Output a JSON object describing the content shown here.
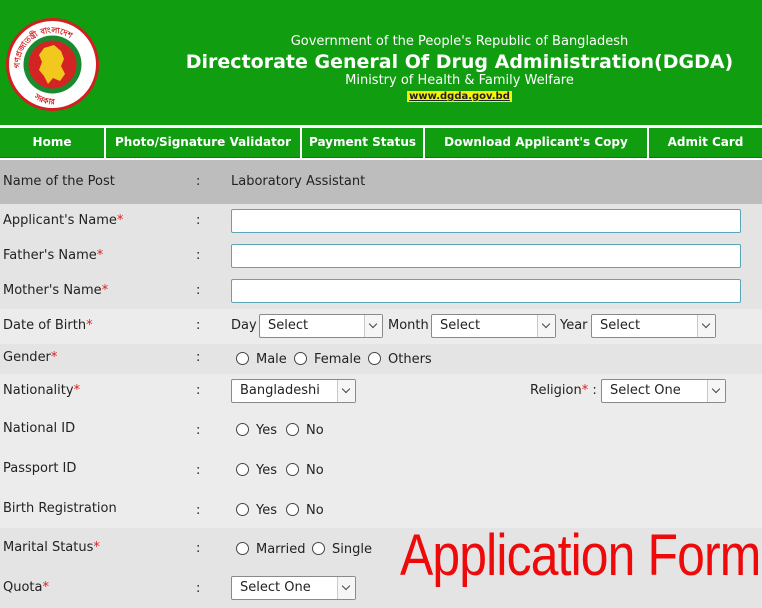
{
  "header": {
    "logo_text_top": "গণপ্রজাতন্ত্রী বাংলাদেশ",
    "logo_text_bottom": "সরকার",
    "government": "Government of the People's Republic of Bangladesh",
    "title": "Directorate General Of Drug Administration(DGDA)",
    "ministry": "Ministry of Health & Family Welfare",
    "url": "www.dgda.gov.bd",
    "bg_color": "#109d10"
  },
  "nav": {
    "items": [
      {
        "label": "Home"
      },
      {
        "label": "Photo/Signature Validator"
      },
      {
        "label": "Payment Status"
      },
      {
        "label": "Download Applicant's Copy"
      },
      {
        "label": "Admit Card"
      }
    ]
  },
  "form": {
    "colon": ":",
    "required_mark": "*",
    "post": {
      "label": "Name of the Post",
      "value": "Laboratory Assistant"
    },
    "applicant_name": {
      "label": "Applicant's Name",
      "value": ""
    },
    "father_name": {
      "label": "Father's Name",
      "value": ""
    },
    "mother_name": {
      "label": "Mother's Name",
      "value": ""
    },
    "dob": {
      "label": "Date of Birth",
      "day_label": "Day",
      "day_value": "Select",
      "month_label": "Month",
      "month_value": "Select",
      "year_label": "Year",
      "year_value": "Select"
    },
    "gender": {
      "label": "Gender",
      "options": [
        "Male",
        "Female",
        "Others"
      ]
    },
    "nationality": {
      "label": "Nationality",
      "value": "Bangladeshi"
    },
    "religion": {
      "label": "Religion",
      "value": "Select One"
    },
    "national_id": {
      "label": "National ID",
      "options": [
        "Yes",
        "No"
      ]
    },
    "passport_id": {
      "label": "Passport ID",
      "options": [
        "Yes",
        "No"
      ]
    },
    "birth_registration": {
      "label": "Birth Registration",
      "options": [
        "Yes",
        "No"
      ]
    },
    "marital_status": {
      "label": "Marital Status",
      "options": [
        "Married",
        "Single"
      ]
    },
    "quota": {
      "label": "Quota",
      "value": "Select One"
    }
  },
  "overlay_text": "Application Form",
  "colors": {
    "required": "#e01b1b",
    "overlay": "#ee0a0a",
    "input_border": "#5aa5b7"
  }
}
